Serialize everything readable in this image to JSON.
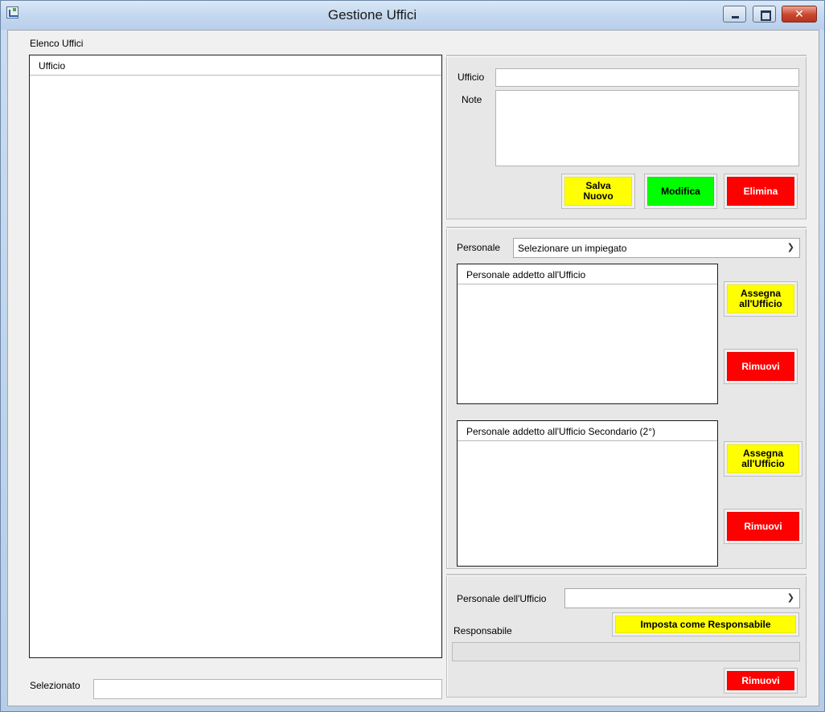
{
  "window": {
    "title": "Gestione Uffici"
  },
  "left": {
    "list_title": "Elenco Uffici",
    "list_column": "Ufficio",
    "selected_label": "Selezionato",
    "selected_value": ""
  },
  "office_form": {
    "ufficio_label": "Ufficio",
    "ufficio_value": "",
    "note_label": "Note",
    "note_value": "",
    "save_label_1": "Salva",
    "save_label_2": "Nuovo",
    "edit_label": "Modifica",
    "delete_label": "Elimina"
  },
  "staff": {
    "personale_label": "Personale",
    "personale_selected": "Selezionare un impiegato",
    "primary_list_header": "Personale addetto all'Ufficio",
    "secondary_list_header": "Personale addetto all'Ufficio Secondario (2°)",
    "assign_label_1": "Assegna",
    "assign_label_2": "all'Ufficio",
    "remove_label": "Rimuovi"
  },
  "manager": {
    "office_staff_label": "Personale dell'Ufficio",
    "office_staff_selected": "",
    "set_manager_label": "Imposta come Responsabile",
    "manager_label": "Responsabile",
    "manager_value": "",
    "remove_label": "Rimuovi"
  },
  "colors": {
    "yellow": "#ffff00",
    "green": "#00ff00",
    "red": "#ff0000"
  }
}
